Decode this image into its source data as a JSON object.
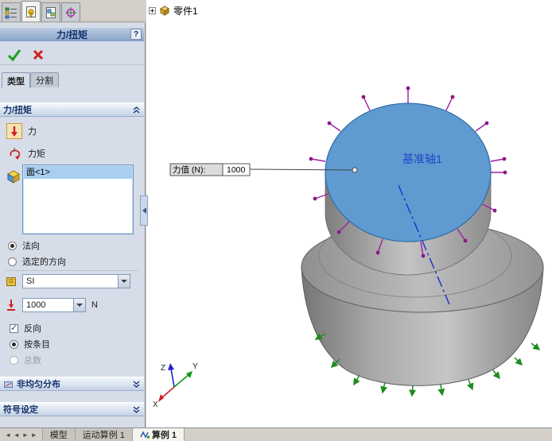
{
  "top_tabs": {
    "items": [
      {
        "name": "featuremanager"
      },
      {
        "name": "propertymanager"
      },
      {
        "name": "configurationmanager"
      },
      {
        "name": "dimxpert"
      }
    ]
  },
  "panel": {
    "title": "力/扭矩",
    "help_label": "?",
    "tabs": {
      "type": "类型",
      "split": "分割"
    },
    "group_main": {
      "title": "力/扭矩",
      "force": "力",
      "torque": "力矩",
      "selection_item": "面<1>",
      "normal": "法向",
      "selected_direction": "选定的方向",
      "unit": "SI",
      "value": "1000",
      "unit_suffix": "N",
      "reverse": "反向",
      "per_item": "按条目",
      "total": "总数"
    },
    "group_nonuniform": "非均匀分布",
    "group_symbol": "符号设定"
  },
  "viewport": {
    "tree_root": "零件1",
    "callout_label": "力值 (N):",
    "callout_value": "1000",
    "axis_label": "基准轴1",
    "triad": {
      "x": "X",
      "y": "Y",
      "z": "Z"
    }
  },
  "statusbar": {
    "nav": [
      "◄",
      "◄",
      "►",
      "►"
    ],
    "tabs": [
      {
        "label": "模型"
      },
      {
        "label": "运动算例 1"
      },
      {
        "label": "算例 1"
      }
    ]
  },
  "colors": {
    "selected_face_blue": "#5f9bd0",
    "force_arrow_purple": "#a020a0",
    "fixture_arrow_green": "#1e8c1e",
    "axis_blue": "#2233cc",
    "header_navy": "#14316b"
  }
}
